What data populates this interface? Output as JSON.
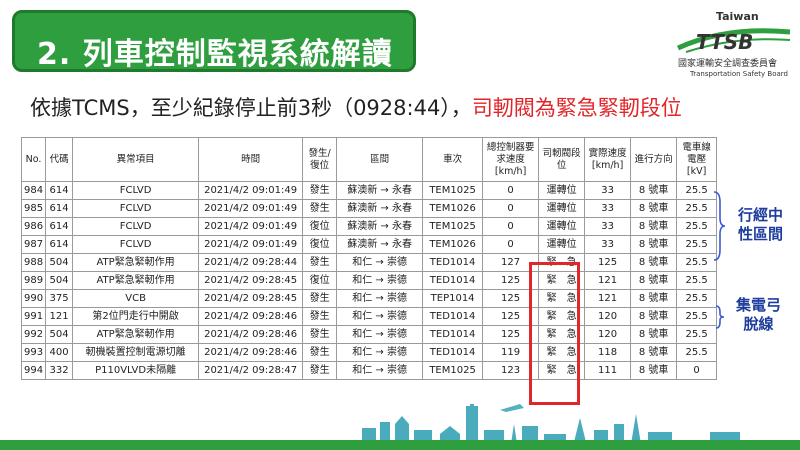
{
  "title": "2. 列車控制監視系統解讀",
  "logo": {
    "taiwan": "Taiwan",
    "abbr": "TTSB",
    "name_cn": "國家運輸安全調查委員會",
    "name_en": "Transportation Safety Board"
  },
  "subtitle": {
    "normal": "依據TCMS，至少紀錄停止前3秒（0928:44），",
    "highlight": "司軔閥為緊急緊軔段位"
  },
  "table": {
    "headers": [
      "No.",
      "代碼",
      "異常項目",
      "時間",
      "發生/復位",
      "區間",
      "車次",
      "總控制器要求速度[km/h]",
      "司軔閥段位",
      "實際速度[km/h]",
      "進行方向",
      "電車線電壓[kV]"
    ],
    "rows": [
      [
        "984",
        "614",
        "FCLVD",
        "2021/4/2 09:01:49",
        "發生",
        "蘇澳新 → 永春",
        "TEM1025",
        "0",
        "運轉位",
        "33",
        "8 號車",
        "25.5"
      ],
      [
        "985",
        "614",
        "FCLVD",
        "2021/4/2 09:01:49",
        "發生",
        "蘇澳新 → 永春",
        "TEM1026",
        "0",
        "運轉位",
        "33",
        "8 號車",
        "25.5"
      ],
      [
        "986",
        "614",
        "FCLVD",
        "2021/4/2 09:01:49",
        "復位",
        "蘇澳新 → 永春",
        "TEM1025",
        "0",
        "運轉位",
        "33",
        "8 號車",
        "25.5"
      ],
      [
        "987",
        "614",
        "FCLVD",
        "2021/4/2 09:01:49",
        "復位",
        "蘇澳新 → 永春",
        "TEM1026",
        "0",
        "運轉位",
        "33",
        "8 號車",
        "25.5"
      ],
      [
        "988",
        "504",
        "ATP緊急緊軔作用",
        "2021/4/2 09:28:44",
        "發生",
        "和仁 → 崇德",
        "TED1014",
        "127",
        "緊　急",
        "125",
        "8 號車",
        "25.5"
      ],
      [
        "989",
        "504",
        "ATP緊急緊軔作用",
        "2021/4/2 09:28:45",
        "復位",
        "和仁 → 崇德",
        "TED1014",
        "125",
        "緊　急",
        "121",
        "8 號車",
        "25.5"
      ],
      [
        "990",
        "375",
        "VCB",
        "2021/4/2 09:28:45",
        "發生",
        "和仁 → 崇德",
        "TEP1014",
        "125",
        "緊　急",
        "121",
        "8 號車",
        "25.5"
      ],
      [
        "991",
        "121",
        "第2位門走行中開啟",
        "2021/4/2 09:28:46",
        "發生",
        "和仁 → 崇德",
        "TED1014",
        "125",
        "緊　急",
        "120",
        "8 號車",
        "25.5"
      ],
      [
        "992",
        "504",
        "ATP緊急緊軔作用",
        "2021/4/2 09:28:46",
        "發生",
        "和仁 → 崇德",
        "TED1014",
        "125",
        "緊　急",
        "120",
        "8 號車",
        "25.5"
      ],
      [
        "993",
        "400",
        "軔機裝置控制電源切離",
        "2021/4/2 09:28:46",
        "發生",
        "和仁 → 崇德",
        "TED1014",
        "119",
        "緊　急",
        "118",
        "8 號車",
        "25.5"
      ],
      [
        "994",
        "332",
        "P110VLVD未隔離",
        "2021/4/2 09:28:47",
        "發生",
        "和仁 → 崇德",
        "TEM1025",
        "123",
        "緊　急",
        "111",
        "8 號車",
        "0"
      ]
    ]
  },
  "side_notes": {
    "neutral_line1": "行經中",
    "neutral_line2": "性區間",
    "pantograph_line1": "集電弓",
    "pantograph_line2": "脫線"
  }
}
